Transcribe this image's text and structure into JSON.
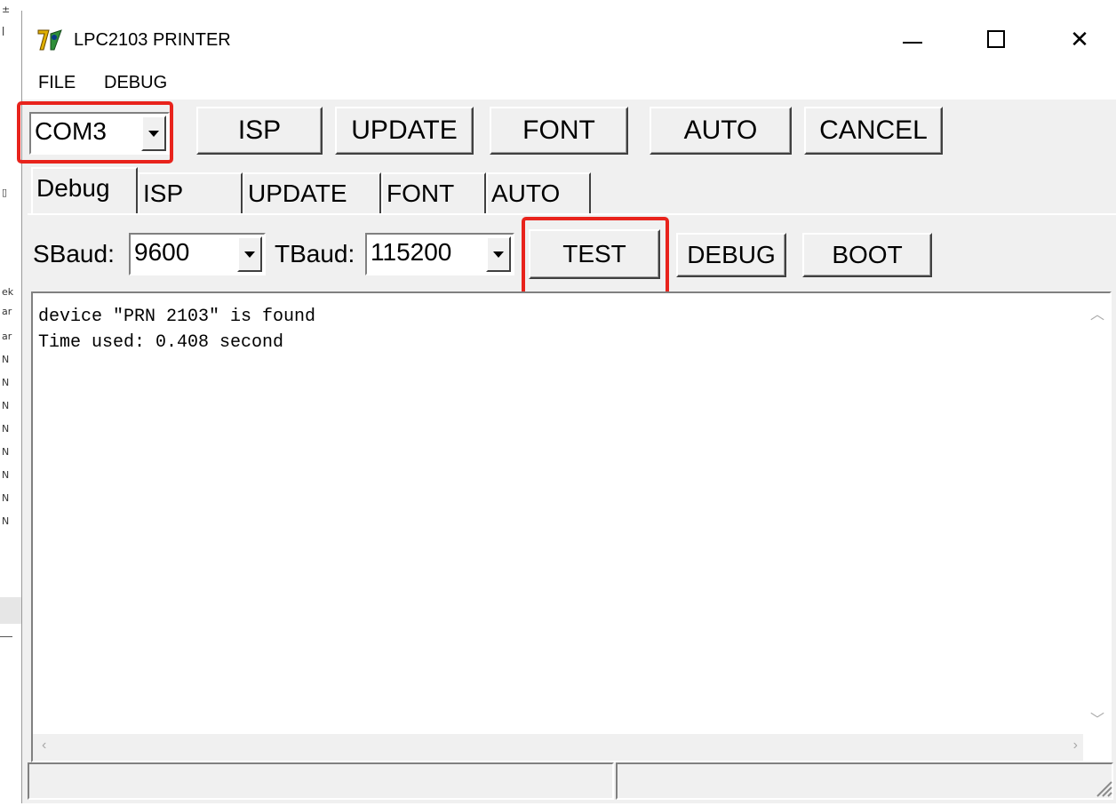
{
  "window": {
    "title": "LPC2103 PRINTER",
    "controls": {
      "minimize": "minimize-icon",
      "maximize": "maximize-icon",
      "close": "close-icon"
    }
  },
  "menu": {
    "file": "FILE",
    "debug": "DEBUG"
  },
  "toolbar": {
    "com_port": "COM3",
    "isp": "ISP",
    "update": "UPDATE",
    "font": "FONT",
    "auto": "AUTO",
    "cancel": "CANCEL"
  },
  "tabs": [
    "Debug",
    "ISP",
    "UPDATE",
    "FONT",
    "AUTO"
  ],
  "debug_panel": {
    "sbaud_label": "SBaud:",
    "sbaud_value": "9600",
    "tbaud_label": "TBaud:",
    "tbaud_value": "115200",
    "test": "TEST",
    "debug": "DEBUG",
    "boot": "BOOT"
  },
  "log": [
    "device \"PRN 2103\" is found",
    "Time used: 0.408 second"
  ],
  "colors": {
    "highlight": "#e8231c",
    "face": "#f0f0f0"
  }
}
